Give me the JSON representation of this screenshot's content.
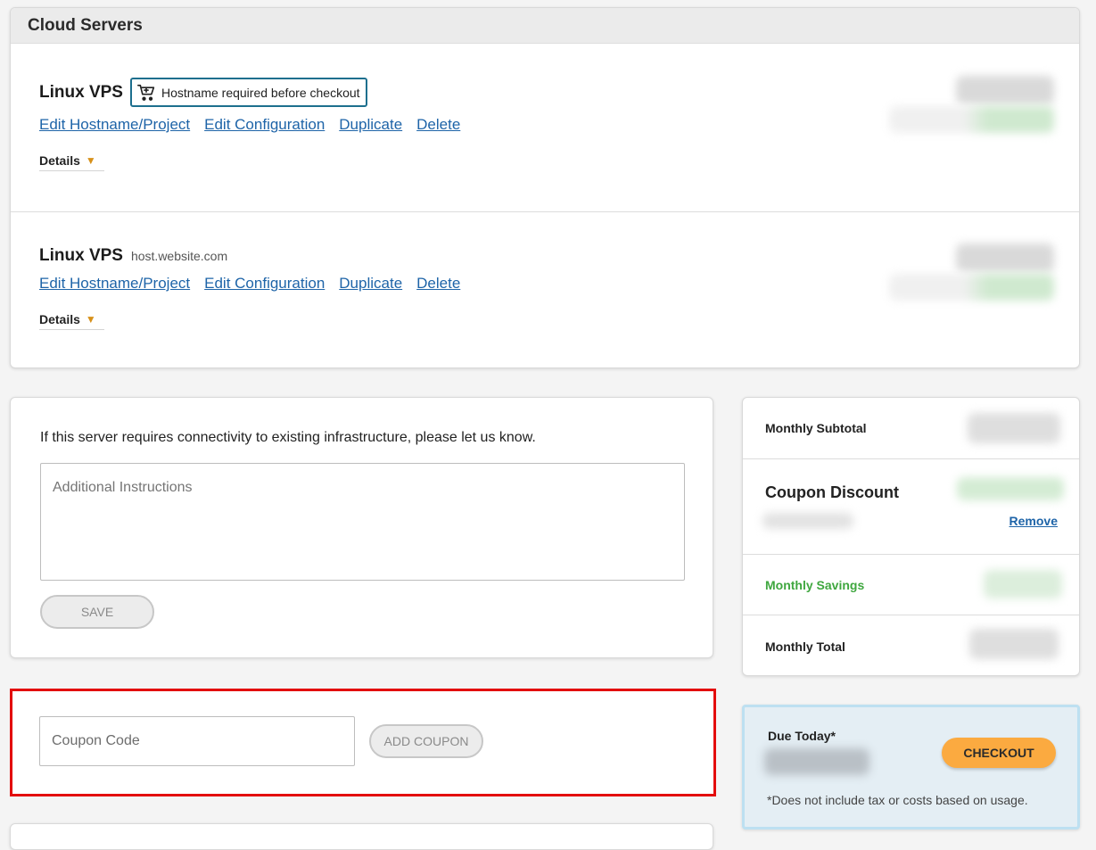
{
  "servers_panel": {
    "title": "Cloud Servers",
    "servers": [
      {
        "name": "Linux VPS",
        "hostname_badge": "Hostname required before checkout",
        "links": [
          "Edit Hostname/Project",
          "Edit Configuration",
          "Duplicate",
          "Delete"
        ],
        "details_label": "Details"
      },
      {
        "name": "Linux VPS",
        "hostname": "host.website.com",
        "links": [
          "Edit Hostname/Project",
          "Edit Configuration",
          "Duplicate",
          "Delete"
        ],
        "details_label": "Details"
      }
    ]
  },
  "instructions": {
    "prompt": "If this server requires connectivity to existing infrastructure, please let us know.",
    "placeholder": "Additional Instructions",
    "save_label": "SAVE"
  },
  "coupon": {
    "placeholder": "Coupon Code",
    "add_label": "ADD COUPON"
  },
  "summary": {
    "monthly_subtotal_label": "Monthly Subtotal",
    "coupon_discount_label": "Coupon Discount",
    "remove_label": "Remove",
    "monthly_savings_label": "Monthly Savings",
    "monthly_total_label": "Monthly Total"
  },
  "due_today": {
    "label": "Due Today*",
    "checkout_label": "CHECKOUT",
    "note": "*Does not include tax or costs based on usage."
  },
  "colors": {
    "link": "#1e64a8",
    "savings_green": "#3fa73f",
    "checkout_orange": "#fbaa40",
    "coupon_highlight_red": "#e30d0d"
  }
}
